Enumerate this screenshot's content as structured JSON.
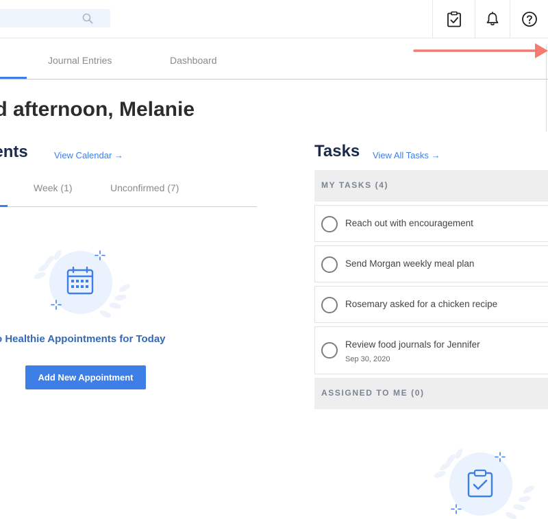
{
  "header": {
    "search": {
      "placeholder": ""
    },
    "icons": [
      {
        "name": "tasks-clipboard-icon"
      },
      {
        "name": "bell-icon"
      },
      {
        "name": "help-icon"
      }
    ]
  },
  "nav": {
    "tabs": [
      {
        "label": "Journal Entries"
      },
      {
        "label": "Dashboard"
      }
    ]
  },
  "greeting": "od afternoon, Melanie",
  "appointments": {
    "title": "ments",
    "link": "View Calendar →",
    "tabs": [
      {
        "label": "Week (1)"
      },
      {
        "label": "Unconfirmed (7)"
      }
    ],
    "empty_text": "o Healthie Appointments for Today",
    "add_button": "Add New Appointment"
  },
  "tasks": {
    "title": "Tasks",
    "link": "View All Tasks →",
    "my_tasks_header": "MY TASKS (4)",
    "items": [
      {
        "label": "Reach out with encouragement",
        "date": ""
      },
      {
        "label": "Send Morgan weekly meal plan",
        "date": ""
      },
      {
        "label": "Rosemary asked for a chicken recipe",
        "date": ""
      },
      {
        "label": "Review food journals for Jennifer",
        "date": "Sep 30, 2020"
      }
    ],
    "assigned_header": "ASSIGNED TO ME (0)"
  },
  "colors": {
    "accent": "#3d7fe6",
    "heading": "#1a2a4e",
    "annotation_arrow": "#f37b70",
    "illustration_bg": "#eaf2fd"
  }
}
